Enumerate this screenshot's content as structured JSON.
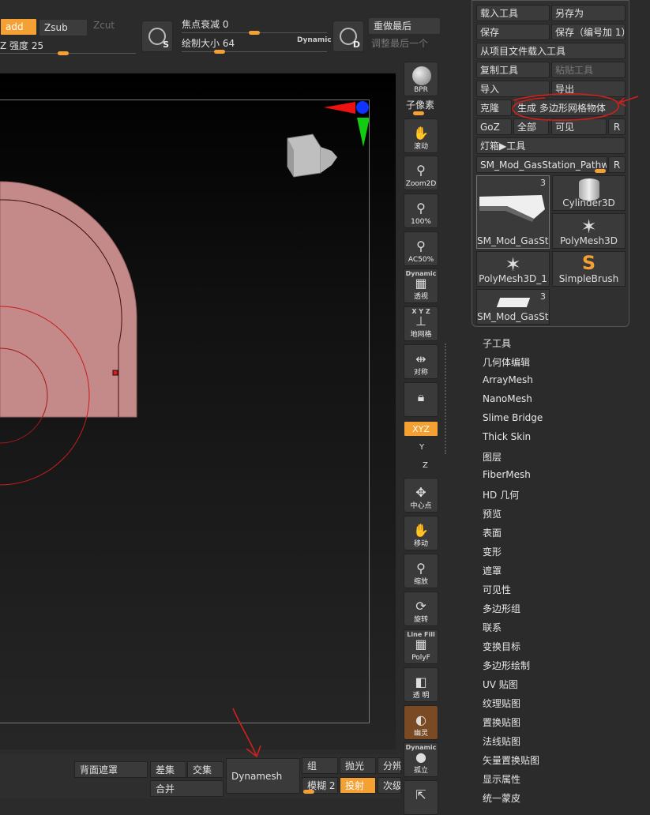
{
  "top_toolbar": {
    "zadd_label": "add",
    "zsub_label": "Zsub",
    "zcut_label": "Zcut",
    "intensity_label": "Z 强度 25",
    "focal_shift_label": "焦点衰减 0",
    "draw_size_label": "绘制大小 64",
    "dynamic_label": "Dynamic",
    "redo_label": "重做最后",
    "adjust_last_label": "调整最后一个",
    "s_letter": "S",
    "d_letter": "D"
  },
  "shelf": {
    "bpr": "BPR",
    "subpixel": "子像素",
    "scroll": "滚动",
    "zoom2d": "Zoom2D",
    "pct100": "100%",
    "ac50": "AC50%",
    "dynamic_top": "Dynamic",
    "persp": "透视",
    "floor": "地网格",
    "xyz_top": "X Y Z",
    "sym": "对称",
    "lock": "",
    "xyz_btn": "XYZ",
    "ry": "Y",
    "rz": "Z",
    "center": "中心点",
    "move": "移动",
    "scale": "缩放",
    "rotate": "旋转",
    "linefill_top": "Line Fill",
    "polyf": "PolyF",
    "transp": "透 明",
    "ghost": "幽灵",
    "dynamic_top2": "Dynamic",
    "solo": "孤立"
  },
  "tool_panel": {
    "load_tool": "载入工具",
    "save_as": "另存为",
    "save": "保存",
    "save_inc": "保存（编号加 1）",
    "load_from_project": "从项目文件载入工具",
    "copy_tool": "复制工具",
    "paste_tool": "粘贴工具",
    "import": "导入",
    "export": "导出",
    "clone": "克隆",
    "make_polymesh": "生成 多边形网格物体",
    "goz": "GoZ",
    "all": "全部",
    "visible": "可见",
    "r": "R",
    "lightbox_tools": "灯箱▶工具",
    "current_tool": "SM_Mod_GasStation_Pathw",
    "r2": "R",
    "thumbs": [
      {
        "name": "SM_Mod_GasSta",
        "count": "3"
      },
      {
        "name": "Cylinder3D",
        "count": ""
      },
      {
        "name": "",
        "count": ""
      },
      {
        "name": "PolyMesh3D",
        "count": ""
      },
      {
        "name": "PolyMesh3D_1",
        "count": ""
      },
      {
        "name": "SimpleBrush",
        "count": ""
      },
      {
        "name": "SM_Mod_GasSta",
        "count": "3"
      }
    ]
  },
  "menu": [
    "子工具",
    "几何体编辑",
    "ArrayMesh",
    "NanoMesh",
    "Slime Bridge",
    "Thick Skin",
    "图层",
    "FiberMesh",
    "HD 几何",
    "预览",
    "表面",
    "变形",
    "遮罩",
    "可见性",
    "多边形组",
    "联系",
    "变换目标",
    "多边形绘制",
    "UV 贴图",
    "纹理贴图",
    "置换贴图",
    "法线贴图",
    "矢量置换贴图",
    "显示属性",
    "统一蒙皮"
  ],
  "bottom_bar": {
    "backface_mask": "背面遮罩",
    "difference": "差集",
    "intersect": "交集",
    "union": "合并",
    "dynamesh": "Dynamesh",
    "groups": "组",
    "polish": "抛光",
    "resolution": "分辨",
    "blur": "模糊 2",
    "project": "投射",
    "sub": "次级"
  },
  "colors": {
    "accent": "#f5a033",
    "annotation": "#d0201c",
    "mesh": "#c48989"
  }
}
